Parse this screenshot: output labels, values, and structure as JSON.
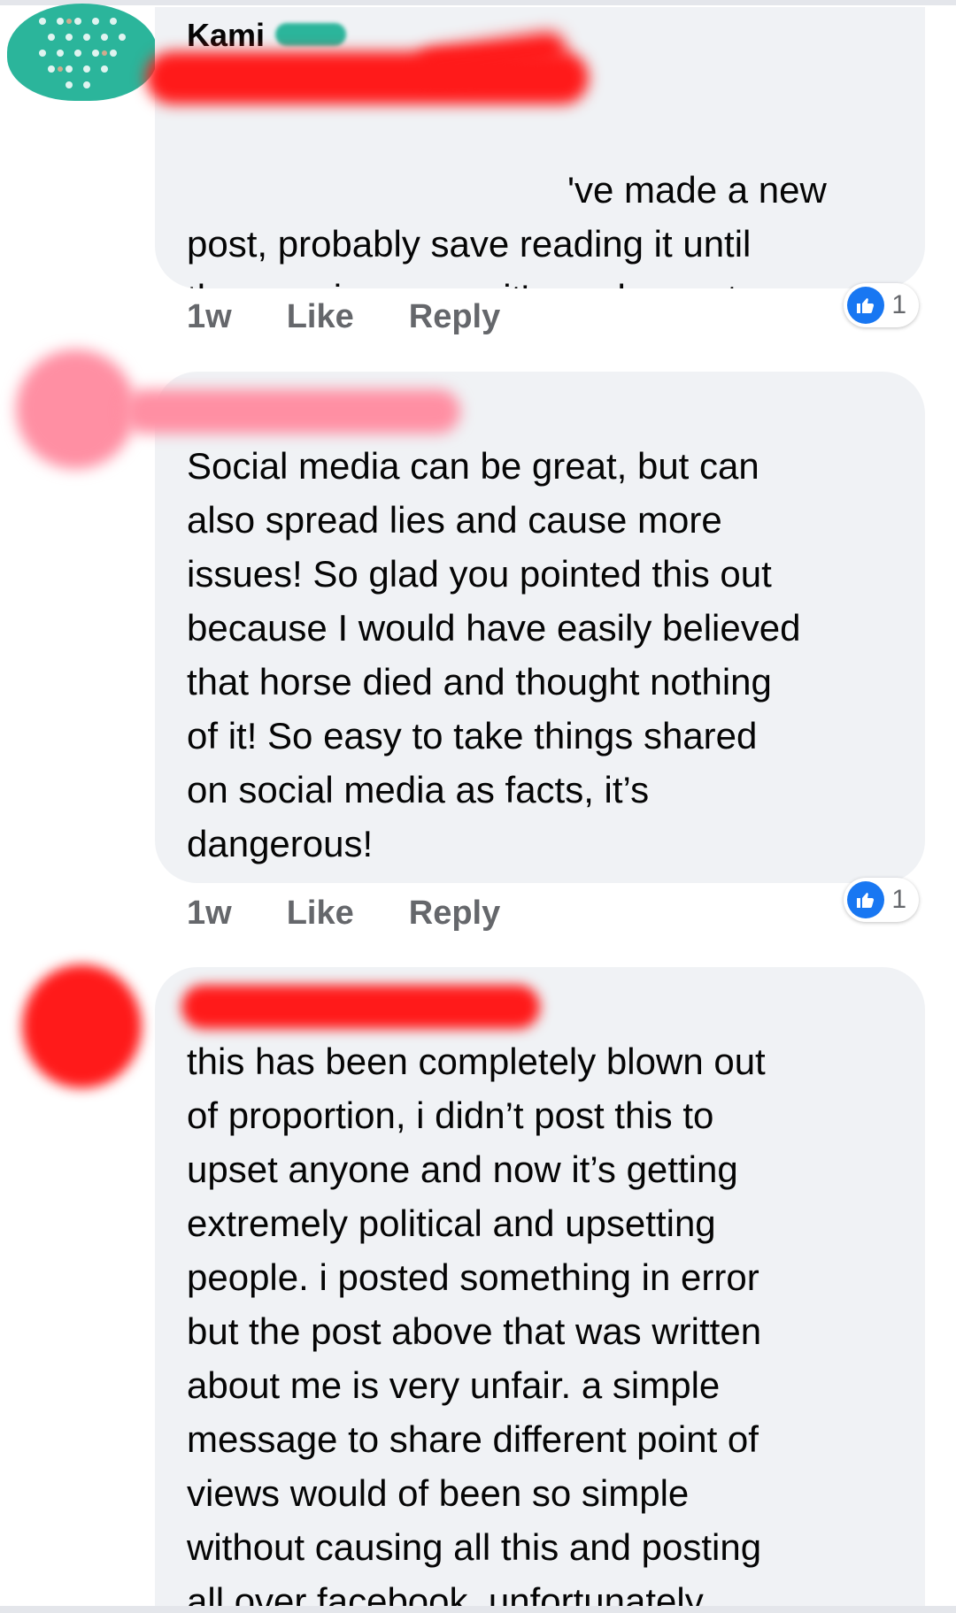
{
  "colors": {
    "bubble": "#f0f2f5",
    "meta_text": "#65676b",
    "like_blue": "#1877f2",
    "redaction_red": "#ff1a1a",
    "redaction_pink": "#ff8fa3",
    "avatar_teal": "#2bb59b"
  },
  "comments": [
    {
      "author_visible": "Kami",
      "text": "'ve made a new\npost, probably save reading it until\nthe morning cause it's my longest\nyet. But just so you know x",
      "timestamp": "1w",
      "like_label": "Like",
      "reply_label": "Reply",
      "reaction_count": "1",
      "reaction_icon": "thumbs-up-icon"
    },
    {
      "author_visible": "",
      "text": "Social media can be great, but can\nalso spread lies and cause more\nissues! So glad you pointed this out\nbecause I would have easily believed\nthat horse died and thought nothing\nof it! So easy to take things shared\non social media as facts, it’s\ndangerous!",
      "timestamp": "1w",
      "like_label": "Like",
      "reply_label": "Reply",
      "reaction_count": "1",
      "reaction_icon": "thumbs-up-icon"
    },
    {
      "author_visible": "",
      "text": "this has been completely blown out\nof proportion, i didn’t post this to\nupset anyone and now it’s getting\nextremely political and upsetting\npeople. i posted something in error\nbut the post above that was written\nabout me is very unfair. a simple\nmessage to share different point of\nviews would of been so simple\nwithout causing all this and posting\nall over facebook. unfortunately"
    }
  ]
}
